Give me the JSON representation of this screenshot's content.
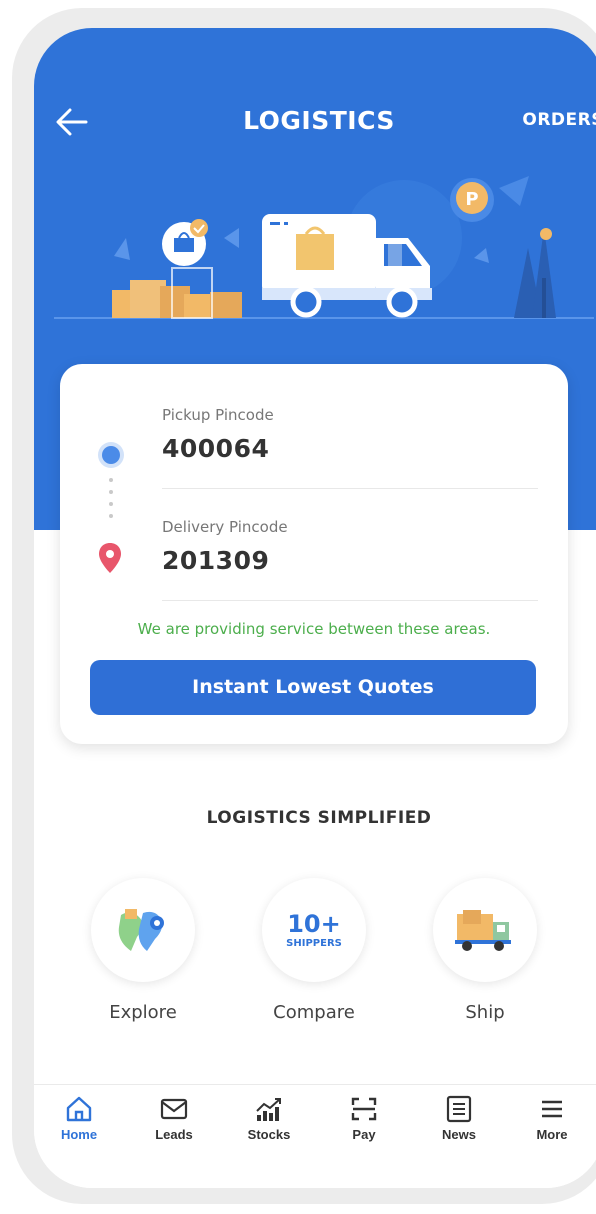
{
  "header": {
    "title": "LOGISTICS",
    "orders_label": "ORDERS"
  },
  "form": {
    "pickup_label": "Pickup Pincode",
    "pickup_value": "400064",
    "delivery_label": "Delivery Pincode",
    "delivery_value": "201309",
    "service_message": "We are providing service between these areas.",
    "quote_button": "Instant Lowest Quotes"
  },
  "features": {
    "title": "LOGISTICS SIMPLIFIED",
    "items": [
      {
        "label": "Explore",
        "icon": "map-pin-icon"
      },
      {
        "label": "Compare",
        "icon": "shippers-badge-icon",
        "badge_number": "10+",
        "badge_text": "SHIPPERS"
      },
      {
        "label": "Ship",
        "icon": "delivery-truck-icon"
      }
    ]
  },
  "nav": {
    "items": [
      {
        "label": "Home",
        "icon": "home-icon",
        "active": true
      },
      {
        "label": "Leads",
        "icon": "mail-icon"
      },
      {
        "label": "Stocks",
        "icon": "chart-icon"
      },
      {
        "label": "Pay",
        "icon": "scan-icon"
      },
      {
        "label": "News",
        "icon": "news-icon"
      },
      {
        "label": "More",
        "icon": "menu-icon"
      }
    ]
  },
  "colors": {
    "primary": "#2f73d8",
    "success": "#4cae4c",
    "pin_red": "#e8566b"
  }
}
